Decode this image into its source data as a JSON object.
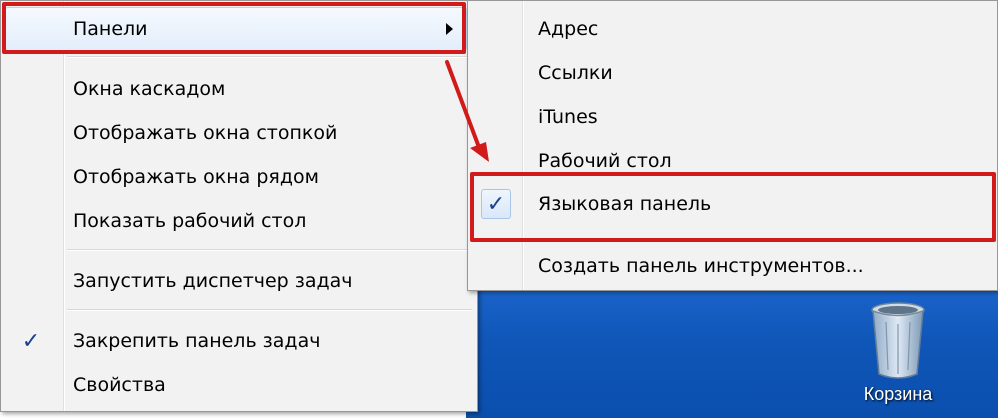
{
  "main_menu": {
    "panels": "Панели",
    "cascade": "Окна каскадом",
    "stack": "Отображать окна стопкой",
    "side_by_side": "Отображать окна рядом",
    "show_desktop": "Показать рабочий стол",
    "task_manager": "Запустить диспетчер задач",
    "lock_taskbar": "Закрепить панель задач",
    "properties": "Свойства",
    "lock_taskbar_checked": true
  },
  "submenu": {
    "address": "Адрес",
    "links": "Ссылки",
    "itunes": "iTunes",
    "desktop": "Рабочий стол",
    "language_bar": "Языковая панель",
    "new_toolbar": "Создать панель инструментов...",
    "language_bar_checked": true
  },
  "desktop": {
    "recycle_bin_label": "Корзина"
  },
  "colors": {
    "highlight": "#d11a1a",
    "menu_bg": "#f2f2f2",
    "desktop_bg": "#0f56b8"
  },
  "icons": {
    "check": "✓"
  }
}
